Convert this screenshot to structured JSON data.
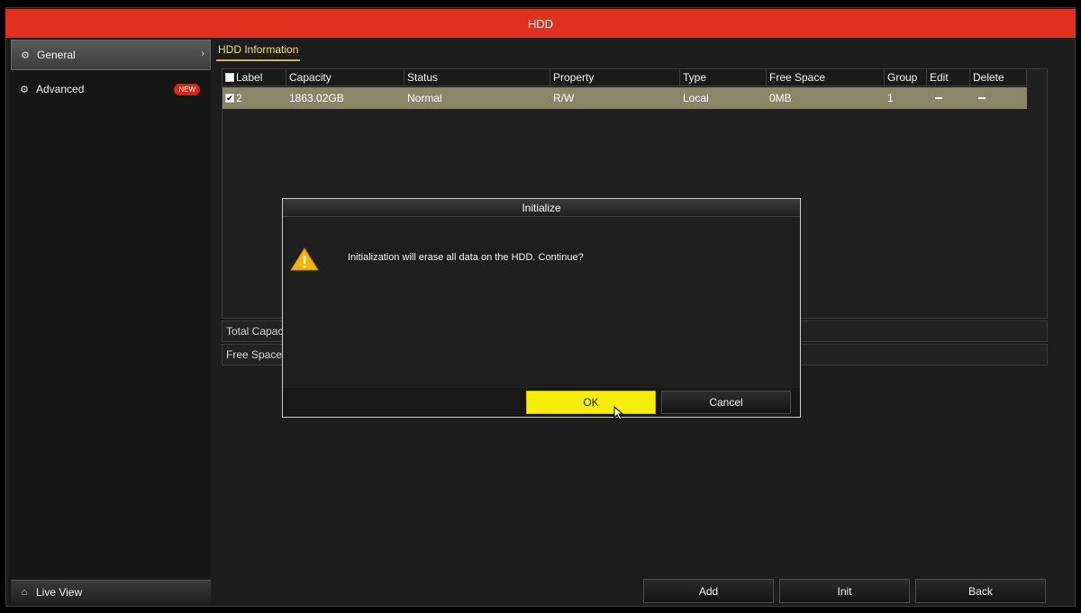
{
  "window": {
    "title": "HDD"
  },
  "sidebar": {
    "items": [
      {
        "label": "General",
        "icon": "gear-icon"
      },
      {
        "label": "Advanced",
        "icon": "gears-icon",
        "badge": "NEW"
      }
    ],
    "live_view": {
      "label": "Live View",
      "icon": "home-icon"
    }
  },
  "main": {
    "tab": "HDD Information",
    "table": {
      "columns": [
        "Label",
        "Capacity",
        "Status",
        "Property",
        "Type",
        "Free Space",
        "Group",
        "Edit",
        "Delete"
      ],
      "rows": [
        {
          "label": "2",
          "checked": true,
          "capacity": "1863.02GB",
          "status": "Normal",
          "property": "R/W",
          "type": "Local",
          "free_space": "0MB",
          "group": "1"
        }
      ]
    },
    "summary": {
      "total_capacity_label": "Total Capac",
      "free_space_label": "Free Space"
    },
    "buttons": {
      "add": "Add",
      "init": "Init",
      "back": "Back"
    }
  },
  "dialog": {
    "title": "Initialize",
    "message": "Initialization will erase all data on the HDD. Continue?",
    "icon": "warning-icon",
    "ok": "OK",
    "cancel": "Cancel"
  },
  "colors": {
    "title_bar": "#e0301e",
    "selected_row": "#8b866a",
    "ok_button": "#f5ee06",
    "tab_accent": "#f0e07a",
    "badge": "#d8251a"
  }
}
